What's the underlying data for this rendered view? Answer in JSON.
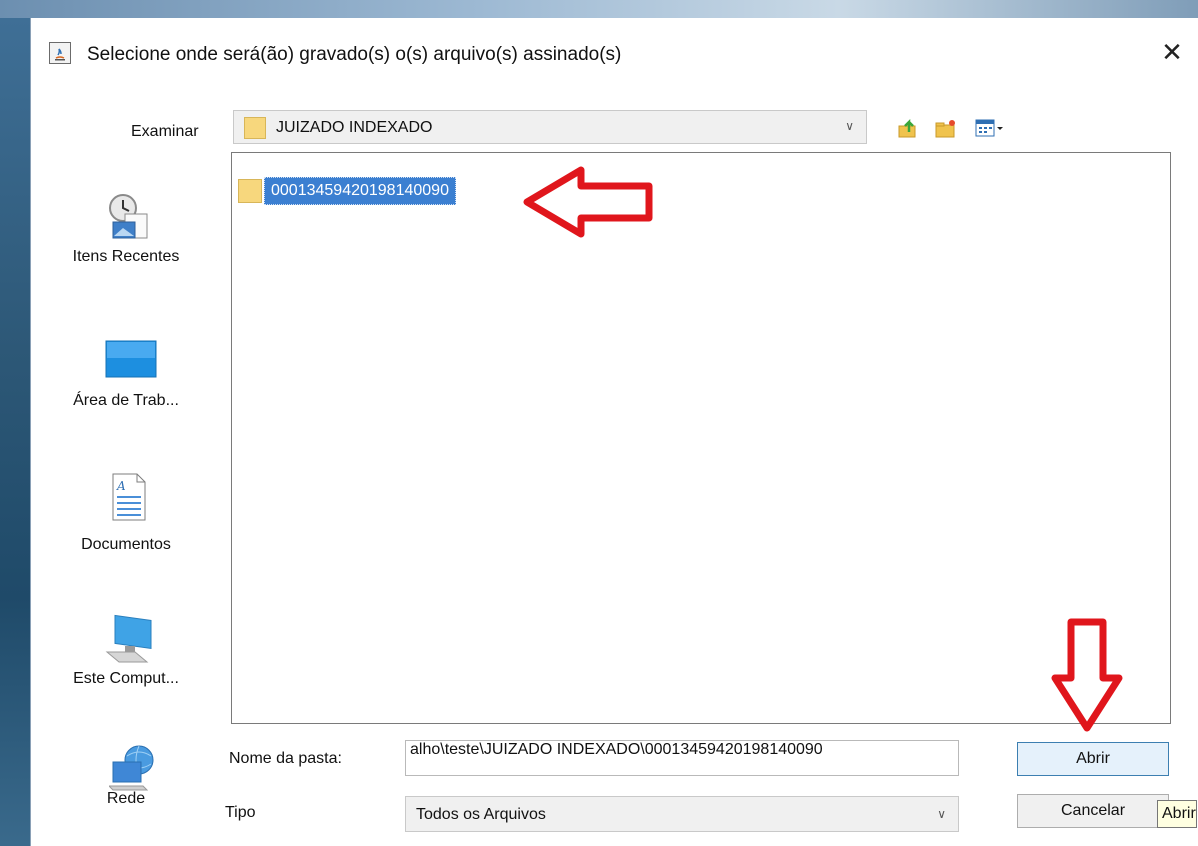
{
  "dialog": {
    "title": "Selecione onde será(ão) gravado(s) o(s) arquivo(s) assinado(s)",
    "close_glyph": "✕"
  },
  "lookin": {
    "label": "Examinar",
    "value": "JUIZADO INDEXADO",
    "toolbar_icons": [
      "up-one-level-icon",
      "new-folder-icon",
      "view-menu-icon"
    ]
  },
  "places": [
    {
      "label": "Itens Recentes",
      "icon": "recent-items-icon"
    },
    {
      "label": "Área de Trab...",
      "icon": "desktop-icon"
    },
    {
      "label": "Documentos",
      "icon": "documents-icon"
    },
    {
      "label": "Este Comput...",
      "icon": "computer-icon"
    },
    {
      "label": "Rede",
      "icon": "network-icon"
    }
  ],
  "files": [
    {
      "name": "00013459420198140090",
      "selected": true
    }
  ],
  "folder_name": {
    "label": "Nome da pasta:",
    "value": "alho\\teste\\JUIZADO INDEXADO\\00013459420198140090"
  },
  "file_type": {
    "label": "Tipo",
    "value": "Todos os Arquivos"
  },
  "buttons": {
    "open": "Abrir",
    "cancel": "Cancelar"
  },
  "tooltip": "Abrir",
  "colors": {
    "selection": "#3b7fd1",
    "annotation_arrow": "#e0161c",
    "folder": "#f7d77d"
  }
}
